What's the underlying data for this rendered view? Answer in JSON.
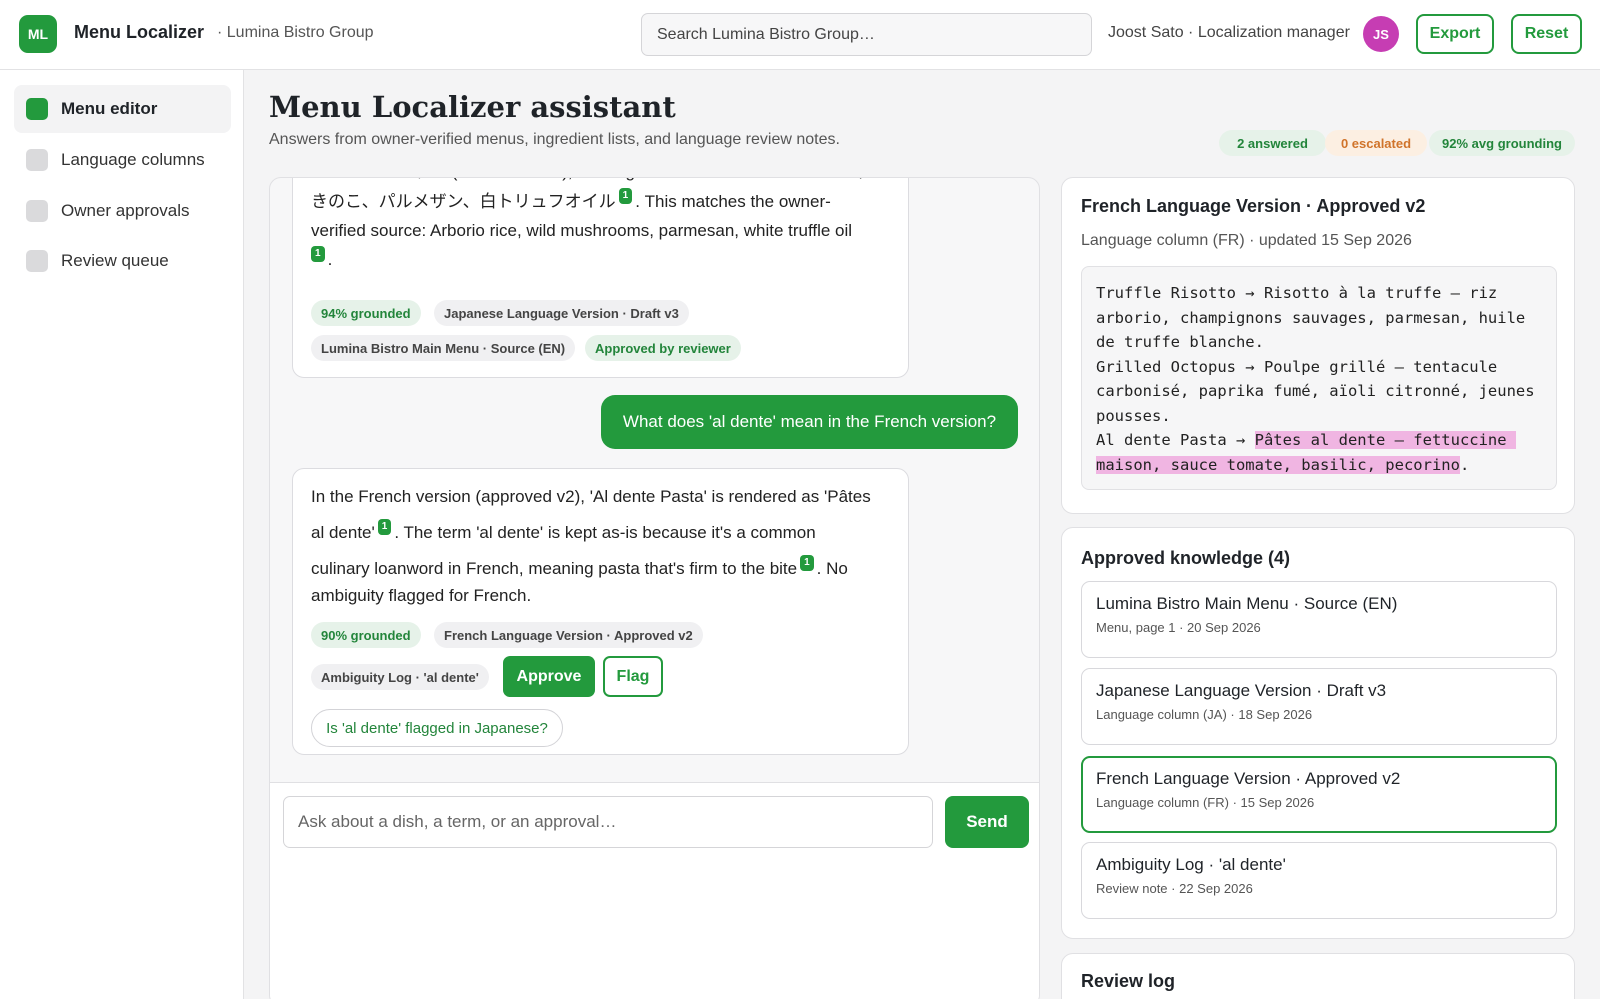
{
  "header": {
    "logo_text": "ML",
    "app_name": "Menu Localizer",
    "org_name": "· Lumina Bistro Group",
    "search_placeholder": "Search Lumina Bistro Group…",
    "user_label": "Joost Sato · Localization manager",
    "avatar_initials": "JS",
    "export_label": "Export",
    "reset_label": "Reset"
  },
  "sidebar": {
    "items": [
      {
        "label": "Menu editor",
        "active": true
      },
      {
        "label": "Language columns",
        "active": false
      },
      {
        "label": "Owner approvals",
        "active": false
      },
      {
        "label": "Review queue",
        "active": false
      }
    ]
  },
  "page": {
    "title": "Menu Localizer assistant",
    "subtitle": "Answers from owner-verified menus, ingredient lists, and language review notes.",
    "stats": [
      "2 answered",
      "0 escalated",
      "92% avg grounding"
    ]
  },
  "chat": {
    "msg1": {
      "partial_top": "トリュフリゾット (Truffle Risotto), with ingredients listed as アルボリオ米、",
      "line2_a": "きのこ、パルメザン、白トリュフオイル",
      "line2_b": ". This matches the owner-",
      "line3": "verified source: Arborio rice, wild mushrooms, parmesan, white truffle oil",
      "end": ".",
      "cite": "1",
      "tag_grounded": "94% grounded",
      "tag_source1": "Japanese Language Version · Draft v3",
      "tag_source2": "Lumina Bistro Main Menu · Source (EN)",
      "tag_status": "Approved by reviewer"
    },
    "user_question": "What does 'al dente' mean in the French version?",
    "msg2": {
      "p1": "In the French version (approved v2), 'Al dente Pasta' is rendered as 'Pâtes",
      "p2": "al dente'",
      "p3": ". The term 'al dente' is kept as-is because it's a common",
      "p4": "culinary loanword in French, meaning pasta that's firm to the bite",
      "p5": ". No",
      "p6": "ambiguity flagged for French.",
      "cite": "1",
      "tag_grounded": "90% grounded",
      "tag_source1": "French Language Version · Approved v2",
      "tag_source2": "Ambiguity Log · 'al dente'",
      "approve_label": "Approve",
      "flag_label": "Flag",
      "suggestion": "Is 'al dente' flagged in Japanese?"
    },
    "composer_placeholder": "Ask about a dish, a term, or an approval…",
    "send_label": "Send"
  },
  "preview": {
    "title": "French Language Version · Approved v2",
    "subtitle": "Language column (FR) · updated 15 Sep 2026",
    "code_plain": "Truffle Risotto → Risotto à la truffe — riz arborio, champignons sauvages, parmesan, huile de truffe blanche.\nGrilled Octopus → Poulpe grillé — tentacule carbonisé, paprika fumé, aïoli citronné, jeunes pousses.\nAl dente Pasta → ",
    "code_highlight": "Pâtes al dente — fettuccine maison, sauce tomate, basilic, pecorino",
    "code_end": "."
  },
  "knowledge": {
    "title": "Approved knowledge (4)",
    "items": [
      {
        "title": "Lumina Bistro Main Menu · Source (EN)",
        "meta": "Menu, page 1 · 20 Sep 2026",
        "selected": false
      },
      {
        "title": "Japanese Language Version · Draft v3",
        "meta": "Language column (JA) · 18 Sep 2026",
        "selected": false
      },
      {
        "title": "French Language Version · Approved v2",
        "meta": "Language column (FR) · 15 Sep 2026",
        "selected": true
      },
      {
        "title": "Ambiguity Log · 'al dente'",
        "meta": "Review note · 22 Sep 2026",
        "selected": false
      }
    ]
  },
  "review_log": {
    "title": "Review log"
  },
  "colors": {
    "accent": "#239a3d",
    "avatar": "#c63db3",
    "highlight": "#f0b5e2",
    "escalated": "#d0742b"
  }
}
